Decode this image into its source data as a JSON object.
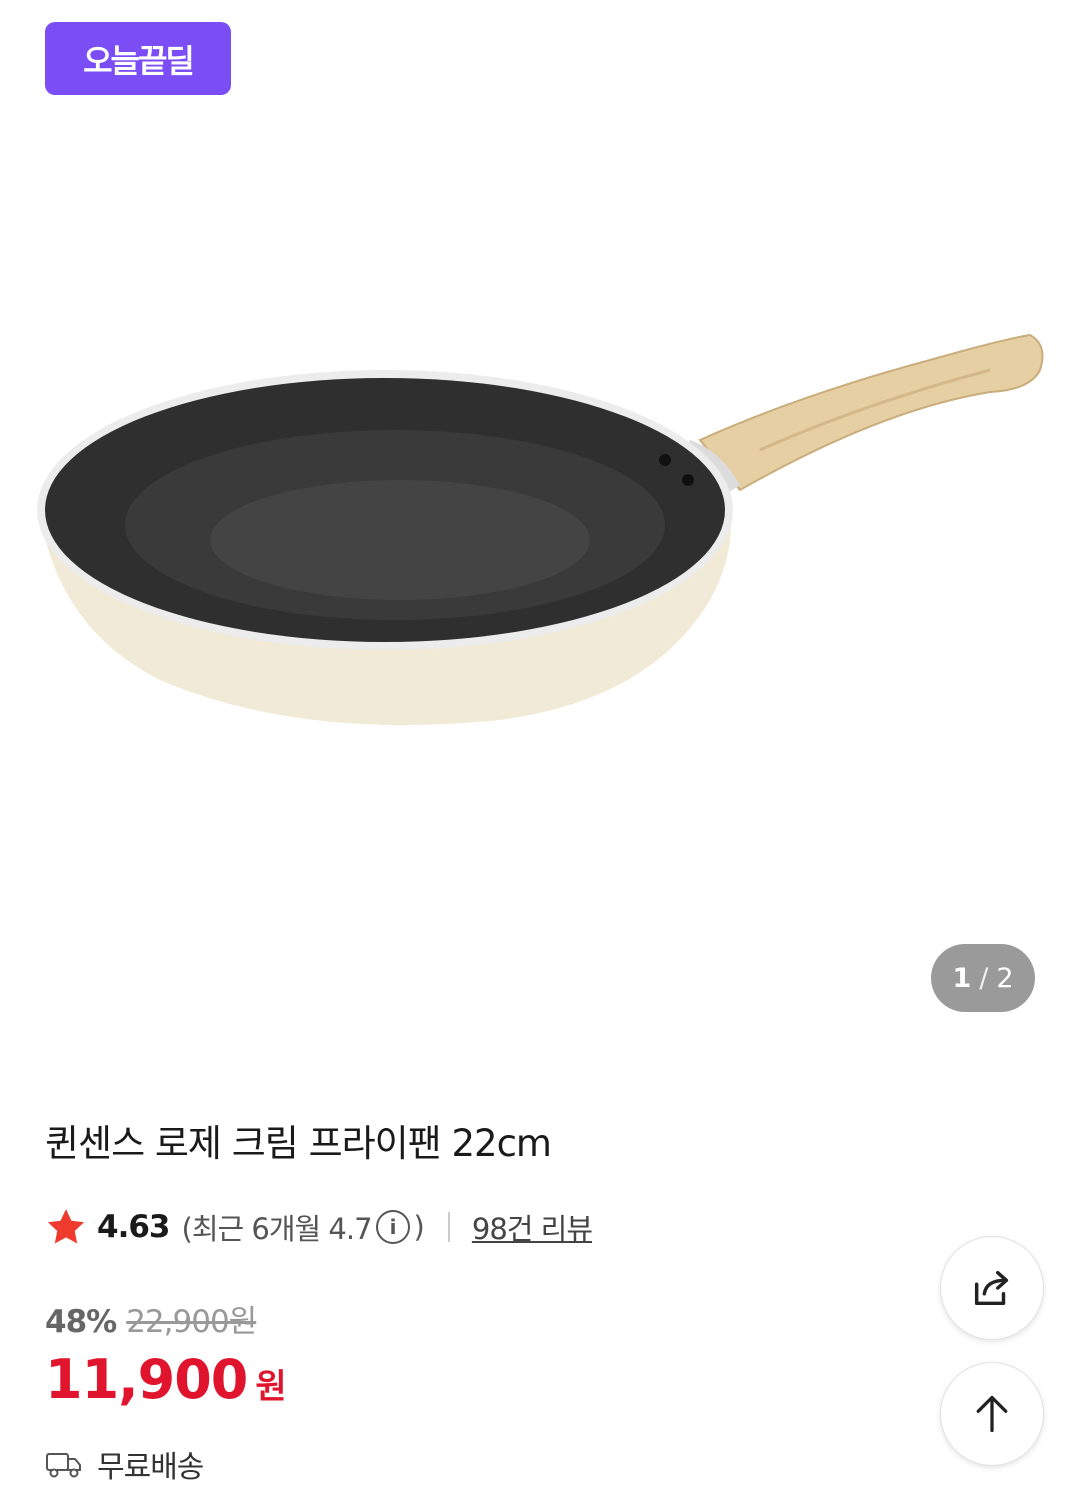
{
  "badge": {
    "label": "오늘끝딜",
    "color": "#7b4df5"
  },
  "gallery": {
    "current": "1",
    "separator": "/",
    "total": "2"
  },
  "product": {
    "title": "퀸센스 로제 크림 프라이팬 22cm"
  },
  "rating": {
    "score": "4.63",
    "recent_prefix": "(최근 6개월 4.7",
    "recent_suffix": ")",
    "reviews": "98건 리뷰",
    "star_color": "#ef3b2d"
  },
  "price": {
    "discount": "48%",
    "original": "22,900원",
    "sale": "11,900",
    "currency": "원",
    "sale_color": "#e0142d"
  },
  "shipping": {
    "label": "무료배송",
    "icon": "truck-icon"
  },
  "actions": {
    "share_icon": "share-icon",
    "top_icon": "arrow-up-icon"
  }
}
